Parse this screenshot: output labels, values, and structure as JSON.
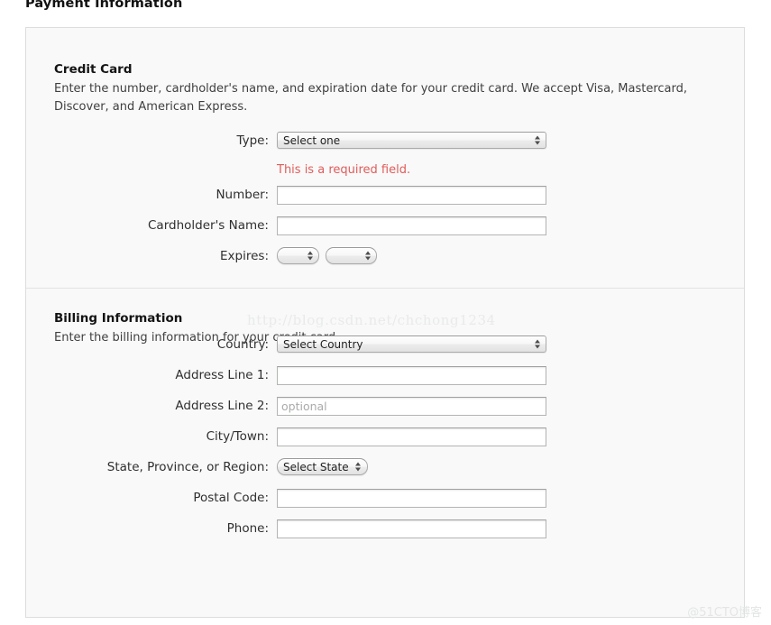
{
  "page": {
    "title": "Payment Information"
  },
  "sections": {
    "credit_card": {
      "heading": "Credit Card",
      "description": "Enter the number, cardholder's name, and expiration date for your credit card. We accept Visa, Mastercard, Discover, and American Express.",
      "fields": {
        "type": {
          "label": "Type:",
          "selected": "Select one",
          "error": "This is a required field."
        },
        "number": {
          "label": "Number:",
          "value": "",
          "placeholder": ""
        },
        "cardholder_name": {
          "label": "Cardholder's Name:",
          "value": "",
          "placeholder": ""
        },
        "expires": {
          "label": "Expires:",
          "month_selected": "",
          "year_selected": ""
        }
      }
    },
    "billing_information": {
      "heading": "Billing Information",
      "description": "Enter the billing information for your credit card.",
      "fields": {
        "country": {
          "label": "Country:",
          "selected": "Select Country"
        },
        "address_line_1": {
          "label": "Address Line 1:",
          "value": "",
          "placeholder": ""
        },
        "address_line_2": {
          "label": "Address Line 2:",
          "value": "",
          "placeholder": "optional"
        },
        "city_town": {
          "label": "City/Town:",
          "value": "",
          "placeholder": ""
        },
        "state_province_region": {
          "label": "State, Province, or Region:",
          "selected": "Select State"
        },
        "postal_code": {
          "label": "Postal Code:",
          "value": "",
          "placeholder": ""
        },
        "phone": {
          "label": "Phone:",
          "value": "",
          "placeholder": ""
        }
      }
    }
  },
  "watermarks": {
    "url": "http://blog.csdn.net/chchong1234",
    "brand": "@51CTO博客"
  },
  "colors": {
    "error_text": "#e05c5c",
    "panel_background": "#f8f9f8",
    "panel_border": "#dcdedc",
    "input_border": "#b3b6b3",
    "placeholder_text": "#a9aba9",
    "watermark": "#e9eaea"
  }
}
